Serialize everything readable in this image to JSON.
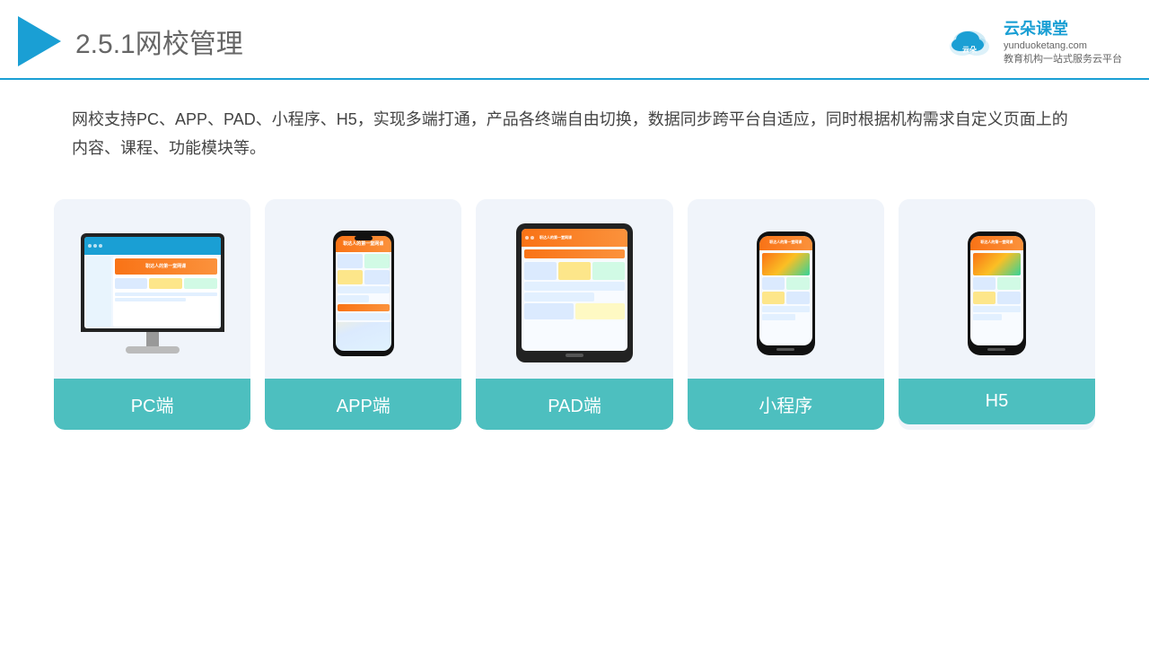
{
  "header": {
    "section": "2.5.1",
    "title": "网校管理",
    "brand_name": "云朵课堂",
    "brand_url": "yunduoketang.com",
    "brand_tagline": "教育机构一站\n式服务云平台"
  },
  "description": "网校支持PC、APP、PAD、小程序、H5，实现多端打通，产品各终端自由切换，数据同步跨平台自适应，同时根据机构需求自定义页面上的内容、课程、功能模块等。",
  "cards": [
    {
      "id": "pc",
      "label": "PC端"
    },
    {
      "id": "app",
      "label": "APP端"
    },
    {
      "id": "pad",
      "label": "PAD端"
    },
    {
      "id": "mini",
      "label": "小程序"
    },
    {
      "id": "h5",
      "label": "H5"
    }
  ]
}
